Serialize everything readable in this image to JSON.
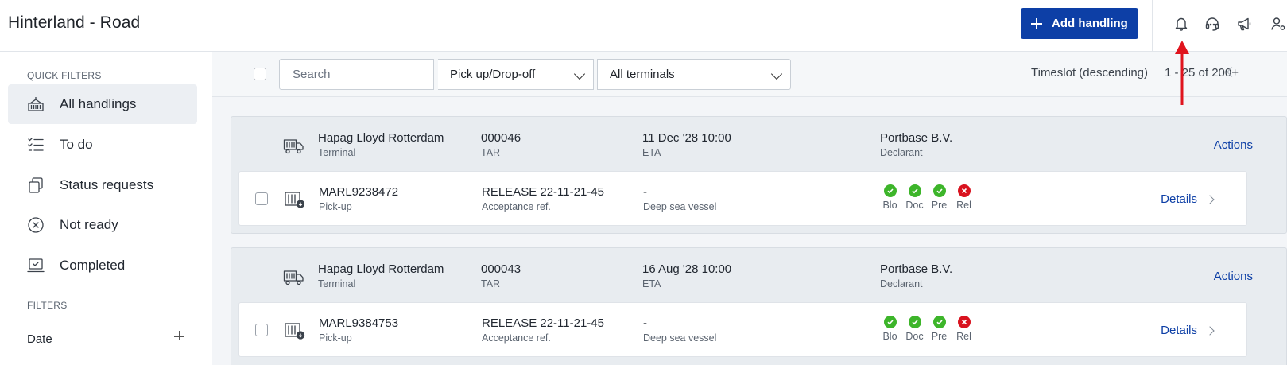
{
  "header": {
    "title": "Hinterland - Road",
    "add_button_label": "Add handling",
    "icons": [
      "bell-icon",
      "headset-icon",
      "megaphone-icon",
      "user-settings-icon"
    ]
  },
  "sidebar": {
    "quick_filters_heading": "QUICK FILTERS",
    "items": [
      {
        "label": "All handlings",
        "icon": "container-icon",
        "active": true
      },
      {
        "label": "To do",
        "icon": "checklist-icon",
        "active": false
      },
      {
        "label": "Status requests",
        "icon": "copy-icon",
        "active": false
      },
      {
        "label": "Not ready",
        "icon": "circle-x-icon",
        "active": false
      },
      {
        "label": "Completed",
        "icon": "laptop-check-icon",
        "active": false
      }
    ],
    "filters_heading": "FILTERS",
    "filter_date_label": "Date"
  },
  "toolbar": {
    "search_placeholder": "Search",
    "type_select": "Pick up/Drop-off",
    "terminal_select": "All terminals",
    "sort_label": "Timeslot (descending)",
    "pagination": "1 - 25 of 200+"
  },
  "handlings": [
    {
      "terminal": "Hapag Lloyd Rotterdam",
      "terminal_label": "Terminal",
      "tar": "000046",
      "tar_label": "TAR",
      "eta": "11 Dec '28 10:00",
      "eta_label": "ETA",
      "declarant": "Portbase B.V.",
      "declarant_label": "Declarant",
      "actions_label": "Actions",
      "container": "MARL9238472",
      "container_type": "Pick-up",
      "acceptance_ref": "RELEASE 22-11-21-45",
      "acceptance_label": "Acceptance ref.",
      "vessel": "-",
      "vessel_label": "Deep sea vessel",
      "statuses": [
        {
          "label": "Blo",
          "state": "ok"
        },
        {
          "label": "Doc",
          "state": "ok"
        },
        {
          "label": "Pre",
          "state": "ok"
        },
        {
          "label": "Rel",
          "state": "error"
        }
      ],
      "details_label": "Details"
    },
    {
      "terminal": "Hapag Lloyd Rotterdam",
      "terminal_label": "Terminal",
      "tar": "000043",
      "tar_label": "TAR",
      "eta": "16 Aug '28 10:00",
      "eta_label": "ETA",
      "declarant": "Portbase B.V.",
      "declarant_label": "Declarant",
      "actions_label": "Actions",
      "container": "MARL9384753",
      "container_type": "Pick-up",
      "acceptance_ref": "RELEASE 22-11-21-45",
      "acceptance_label": "Acceptance ref.",
      "vessel": "-",
      "vessel_label": "Deep sea vessel",
      "statuses": [
        {
          "label": "Blo",
          "state": "ok"
        },
        {
          "label": "Doc",
          "state": "ok"
        },
        {
          "label": "Pre",
          "state": "ok"
        },
        {
          "label": "Rel",
          "state": "error"
        }
      ],
      "details_label": "Details"
    }
  ],
  "colors": {
    "primary": "#0d3fa6",
    "status_ok": "#3db52a",
    "status_error": "#d9131f",
    "annotation": "#e0141e"
  }
}
